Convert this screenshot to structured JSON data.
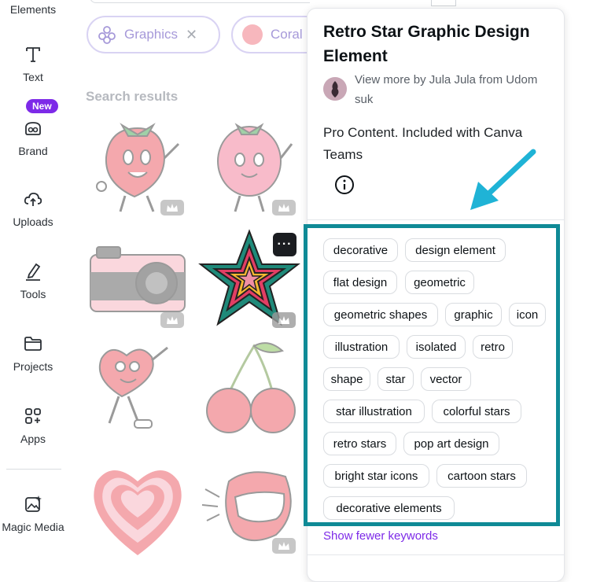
{
  "sidebar": {
    "items": [
      {
        "label": "Elements",
        "icon": "elements-icon"
      },
      {
        "label": "Text",
        "icon": "text-icon"
      },
      {
        "label": "Brand",
        "icon": "brand-icon"
      },
      {
        "label": "Uploads",
        "icon": "cloud-upload-icon"
      },
      {
        "label": "Tools",
        "icon": "pen-tool-icon"
      },
      {
        "label": "Projects",
        "icon": "folder-icon"
      },
      {
        "label": "Apps",
        "icon": "apps-grid-icon"
      },
      {
        "label": "Magic Media",
        "icon": "magic-media-icon"
      }
    ],
    "new_badge": "New"
  },
  "filters": {
    "graphics_label": "Graphics",
    "coral_label": "Coral"
  },
  "results_label": "Search results",
  "panel": {
    "title": "Retro Star Graphic Design Element",
    "author_text": "View more by Jula Jula from Udom suk",
    "pro_text": "Pro Content. Included with Canva Teams",
    "keywords": [
      "decorative",
      "design element",
      "flat design",
      "geometric",
      "geometric shapes",
      "graphic",
      "icon",
      "illustration",
      "isolated",
      "retro",
      "shape",
      "star",
      "vector",
      "star illustration",
      "colorful stars",
      "retro stars",
      "pop art design",
      "bright star icons",
      "cartoon stars",
      "decorative elements"
    ],
    "show_fewer": "Show fewer keywords"
  },
  "colors": {
    "accent_purple": "#7d2ae8",
    "highlight_teal": "#0f8a96",
    "arrow_cyan": "#1fb3d6"
  }
}
